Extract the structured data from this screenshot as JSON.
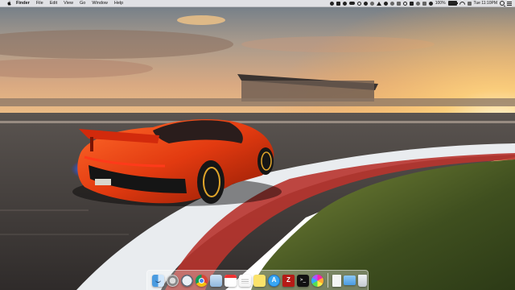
{
  "menubar": {
    "apple_icon": "apple-logo-icon",
    "app_name": "Finder",
    "menus": [
      "File",
      "Edit",
      "View",
      "Go",
      "Window",
      "Help"
    ],
    "battery_percent_label": "100%",
    "battery_level": 1.0,
    "clock": "Tue 11:10PM"
  },
  "dock": {
    "apps": [
      {
        "name": "finder-icon"
      },
      {
        "name": "launchpad-icon"
      },
      {
        "name": "safari-icon"
      },
      {
        "name": "chrome-icon"
      },
      {
        "name": "mail-icon"
      },
      {
        "name": "calendar-icon"
      },
      {
        "name": "notes-icon"
      },
      {
        "name": "stickies-icon"
      },
      {
        "name": "app-store-icon"
      },
      {
        "name": "filezilla-icon"
      },
      {
        "name": "terminal-icon"
      },
      {
        "name": "photos-icon"
      }
    ],
    "filezilla_glyph": "Z",
    "terminal_glyph": ">_",
    "calendar_day": "",
    "stacks": [
      "document-stack-icon",
      "downloads-folder-icon",
      "trash-icon"
    ]
  },
  "wallpaper": {
    "subject": "orange-supercar-on-race-track",
    "plate_text": ""
  },
  "colors": {
    "menubar_bg": "#e8e8ec",
    "car_body": "#e23a10",
    "sky_top": "#6f7f8d",
    "sunset": "#f6b54a"
  }
}
